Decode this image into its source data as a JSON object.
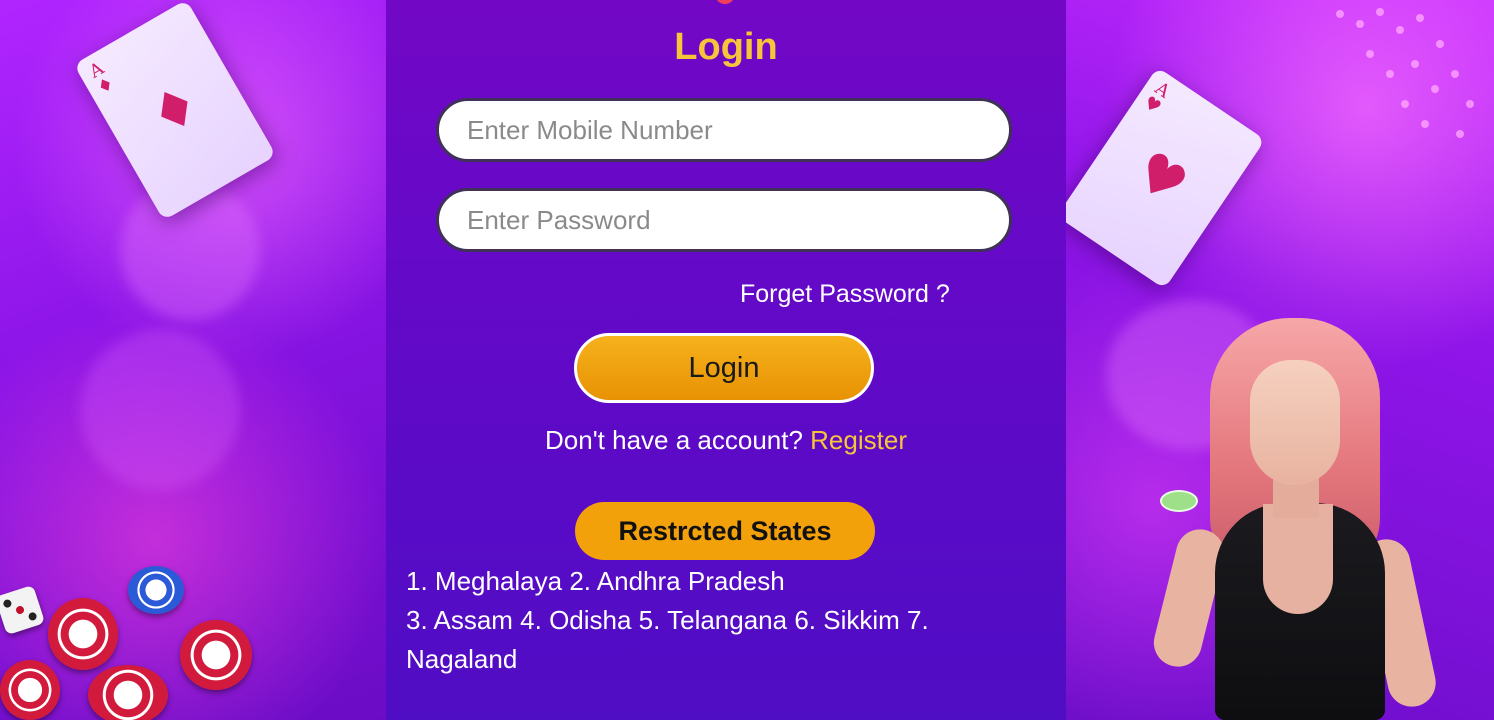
{
  "login": {
    "title": "Login",
    "mobile_placeholder": "Enter Mobile Number",
    "password_placeholder": "Enter Password",
    "forgot_label": "Forget Password ?",
    "button_label": "Login",
    "signup_prompt": "Don't have a account?",
    "register_label": "Register"
  },
  "restricted": {
    "label": "Restrcted States",
    "lines": [
      "1. Meghalaya 2. Andhra Pradesh",
      "3. Assam 4. Odisha 5. Telangana 6. Sikkim 7.",
      "Nagaland"
    ]
  },
  "decor": {
    "left_card": {
      "rank": "A",
      "suit": "♦"
    },
    "right_card": {
      "rank": "A",
      "suit": "♥"
    }
  }
}
